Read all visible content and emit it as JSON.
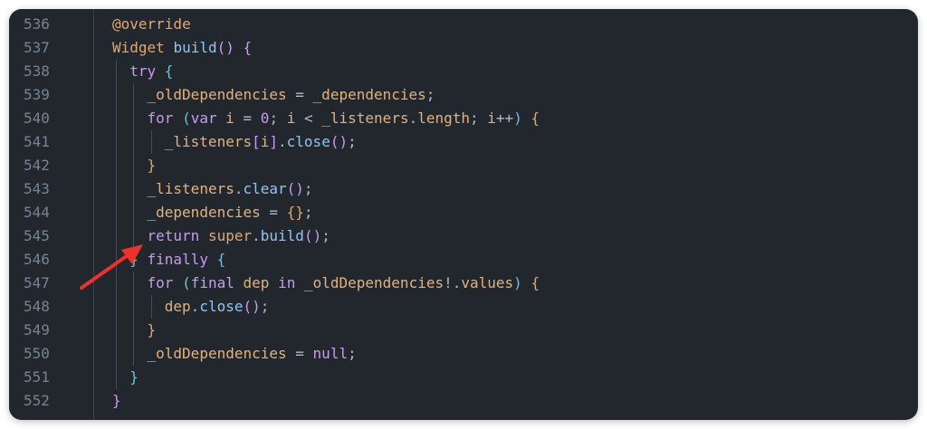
{
  "editor": {
    "language": "dart",
    "lines": [
      {
        "num": "536",
        "indent": 0,
        "tokens": [
          [
            "t-ann",
            "@override"
          ]
        ]
      },
      {
        "num": "537",
        "indent": 0,
        "tokens": [
          [
            "t-type",
            "Widget"
          ],
          [
            "t-pl",
            " "
          ],
          [
            "t-fn",
            "build"
          ],
          [
            "t-brk",
            "()"
          ],
          [
            "t-pl",
            " "
          ],
          [
            "t-brk",
            "{"
          ]
        ]
      },
      {
        "num": "538",
        "indent": 1,
        "tokens": [
          [
            "t-kw",
            "try"
          ],
          [
            "t-pl",
            " "
          ],
          [
            "t-brk2",
            "{"
          ]
        ]
      },
      {
        "num": "539",
        "indent": 2,
        "tokens": [
          [
            "t-id",
            "_oldDependencies"
          ],
          [
            "t-pl",
            " = "
          ],
          [
            "t-id",
            "_dependencies"
          ],
          [
            "t-pl",
            ";"
          ]
        ]
      },
      {
        "num": "540",
        "indent": 2,
        "tokens": [
          [
            "t-kw",
            "for"
          ],
          [
            "t-pl",
            " "
          ],
          [
            "t-brk2",
            "("
          ],
          [
            "t-kw",
            "var"
          ],
          [
            "t-pl",
            " "
          ],
          [
            "t-id",
            "i"
          ],
          [
            "t-pl",
            " = "
          ],
          [
            "t-num",
            "0"
          ],
          [
            "t-pl",
            "; "
          ],
          [
            "t-id",
            "i"
          ],
          [
            "t-pl",
            " < "
          ],
          [
            "t-id",
            "_listeners"
          ],
          [
            "t-pl",
            "."
          ],
          [
            "t-id",
            "length"
          ],
          [
            "t-pl",
            "; "
          ],
          [
            "t-id",
            "i"
          ],
          [
            "t-pl",
            "++"
          ],
          [
            "t-brk2",
            ")"
          ],
          [
            "t-pl",
            " "
          ],
          [
            "t-ann",
            "{"
          ]
        ]
      },
      {
        "num": "541",
        "indent": 3,
        "tokens": [
          [
            "t-id",
            "_listeners"
          ],
          [
            "t-brk",
            "["
          ],
          [
            "t-id",
            "i"
          ],
          [
            "t-brk",
            "]"
          ],
          [
            "t-pl",
            "."
          ],
          [
            "t-fn",
            "close"
          ],
          [
            "t-brk",
            "()"
          ],
          [
            "t-pl",
            ";"
          ]
        ]
      },
      {
        "num": "542",
        "indent": 2,
        "tokens": [
          [
            "t-ann",
            "}"
          ]
        ]
      },
      {
        "num": "543",
        "indent": 2,
        "tokens": [
          [
            "t-id",
            "_listeners"
          ],
          [
            "t-pl",
            "."
          ],
          [
            "t-fn",
            "clear"
          ],
          [
            "t-brk",
            "()"
          ],
          [
            "t-pl",
            ";"
          ]
        ]
      },
      {
        "num": "544",
        "indent": 2,
        "tokens": [
          [
            "t-id",
            "_dependencies"
          ],
          [
            "t-pl",
            " = "
          ],
          [
            "t-ann",
            "{}"
          ],
          [
            "t-pl",
            ";"
          ]
        ]
      },
      {
        "num": "545",
        "indent": 2,
        "tokens": [
          [
            "t-kw",
            "return"
          ],
          [
            "t-pl",
            " "
          ],
          [
            "t-ann",
            "super"
          ],
          [
            "t-pl",
            "."
          ],
          [
            "t-fn",
            "build"
          ],
          [
            "t-brk",
            "()"
          ],
          [
            "t-pl",
            ";"
          ]
        ]
      },
      {
        "num": "546",
        "indent": 1,
        "tokens": [
          [
            "t-brk2",
            "}"
          ],
          [
            "t-pl",
            " "
          ],
          [
            "t-kw",
            "finally"
          ],
          [
            "t-pl",
            " "
          ],
          [
            "t-brk2",
            "{"
          ]
        ]
      },
      {
        "num": "547",
        "indent": 2,
        "tokens": [
          [
            "t-kw",
            "for"
          ],
          [
            "t-pl",
            " "
          ],
          [
            "t-brk2",
            "("
          ],
          [
            "t-kw",
            "final"
          ],
          [
            "t-pl",
            " "
          ],
          [
            "t-id",
            "dep"
          ],
          [
            "t-pl",
            " "
          ],
          [
            "t-kw",
            "in"
          ],
          [
            "t-pl",
            " "
          ],
          [
            "t-id",
            "_oldDependencies"
          ],
          [
            "t-pl",
            "!."
          ],
          [
            "t-id",
            "values"
          ],
          [
            "t-brk2",
            ")"
          ],
          [
            "t-pl",
            " "
          ],
          [
            "t-ann",
            "{"
          ]
        ]
      },
      {
        "num": "548",
        "indent": 3,
        "tokens": [
          [
            "t-id",
            "dep"
          ],
          [
            "t-pl",
            "."
          ],
          [
            "t-fn",
            "close"
          ],
          [
            "t-brk",
            "()"
          ],
          [
            "t-pl",
            ";"
          ]
        ]
      },
      {
        "num": "549",
        "indent": 2,
        "tokens": [
          [
            "t-ann",
            "}"
          ]
        ]
      },
      {
        "num": "550",
        "indent": 2,
        "tokens": [
          [
            "t-id",
            "_oldDependencies"
          ],
          [
            "t-pl",
            " = "
          ],
          [
            "t-kw",
            "null"
          ],
          [
            "t-pl",
            ";"
          ]
        ]
      },
      {
        "num": "551",
        "indent": 1,
        "tokens": [
          [
            "t-brk2",
            "}"
          ]
        ]
      },
      {
        "num": "552",
        "indent": 0,
        "tokens": [
          [
            "t-brk",
            "}"
          ]
        ]
      }
    ]
  },
  "annotation": {
    "arrow_color": "#f0302a",
    "points_to_line": "545"
  },
  "colors": {
    "background": "#22272e",
    "gutter_text": "#768390",
    "keyword": "#c79bf2",
    "function": "#90c4f5",
    "identifier": "#e3b27c"
  }
}
